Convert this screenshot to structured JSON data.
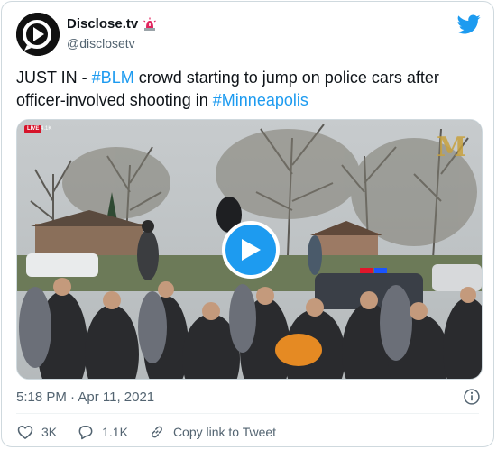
{
  "author": {
    "display_name": "Disclose.tv",
    "handle": "@disclosetv",
    "badge_icon": "siren-emoji-icon"
  },
  "tweet": {
    "prefix": "JUST IN - ",
    "tag1": "#BLM",
    "middle": " crowd starting to jump on police cars after officer-involved shooting in ",
    "tag2": "#Minneapolis"
  },
  "media": {
    "live_label": "LIVE",
    "live_viewers": "4.1K",
    "watermark": "M"
  },
  "timestamp": "5:18 PM · Apr 11, 2021",
  "actions": {
    "likes": "3K",
    "replies": "1.1K",
    "copy_link": "Copy link to Tweet"
  },
  "colors": {
    "accent": "#1d9bf0",
    "text": "#0f1419",
    "secondary": "#536471",
    "border": "#cfd9de"
  }
}
